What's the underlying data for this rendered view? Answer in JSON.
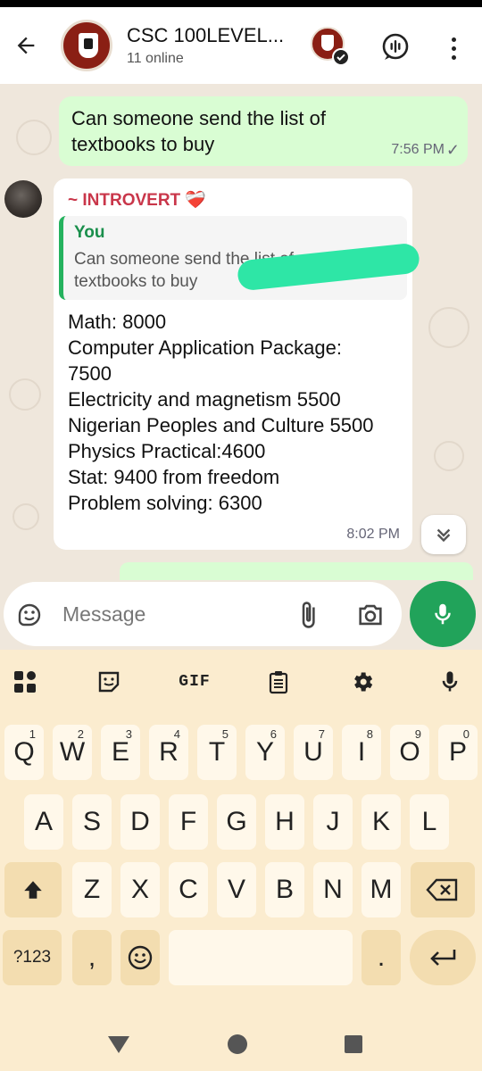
{
  "header": {
    "title": "CSC 100LEVEL...",
    "subtitle": "11 online"
  },
  "messages": {
    "outgoing": {
      "text": "Can someone send the list of textbooks to buy",
      "time": "7:56 PM",
      "status": "✓"
    },
    "incoming": {
      "sender": "~ INTROVERT ❤️‍🩹",
      "quote_author": "You",
      "quote_text": "Can someone send the list of textbooks to buy",
      "body": "Math: 8000\nComputer Application Package: 7500\nElectricity and magnetism 5500\nNigerian Peoples and Culture 5500\nPhysics Practical:4600\nStat: 9400 from freedom\nProblem solving: 6300",
      "time": "8:02 PM"
    }
  },
  "input": {
    "placeholder": "Message"
  },
  "keyboard": {
    "toolbar": {
      "gif_label": "GIF"
    },
    "row1": [
      {
        "key": "Q",
        "hint": "1"
      },
      {
        "key": "W",
        "hint": "2"
      },
      {
        "key": "E",
        "hint": "3"
      },
      {
        "key": "R",
        "hint": "4"
      },
      {
        "key": "T",
        "hint": "5"
      },
      {
        "key": "Y",
        "hint": "6"
      },
      {
        "key": "U",
        "hint": "7"
      },
      {
        "key": "I",
        "hint": "8"
      },
      {
        "key": "O",
        "hint": "9"
      },
      {
        "key": "P",
        "hint": "0"
      }
    ],
    "row2": [
      "A",
      "S",
      "D",
      "F",
      "G",
      "H",
      "J",
      "K",
      "L"
    ],
    "row3": [
      "Z",
      "X",
      "C",
      "V",
      "B",
      "N",
      "M"
    ],
    "symbols_label": "?123",
    "comma_label": ",",
    "period_label": "."
  },
  "colors": {
    "outgoing_bubble": "#d9fdd3",
    "accent_green": "#21a35a",
    "sender_name": "#c9364a",
    "keyboard_bg": "#fbeccf"
  }
}
